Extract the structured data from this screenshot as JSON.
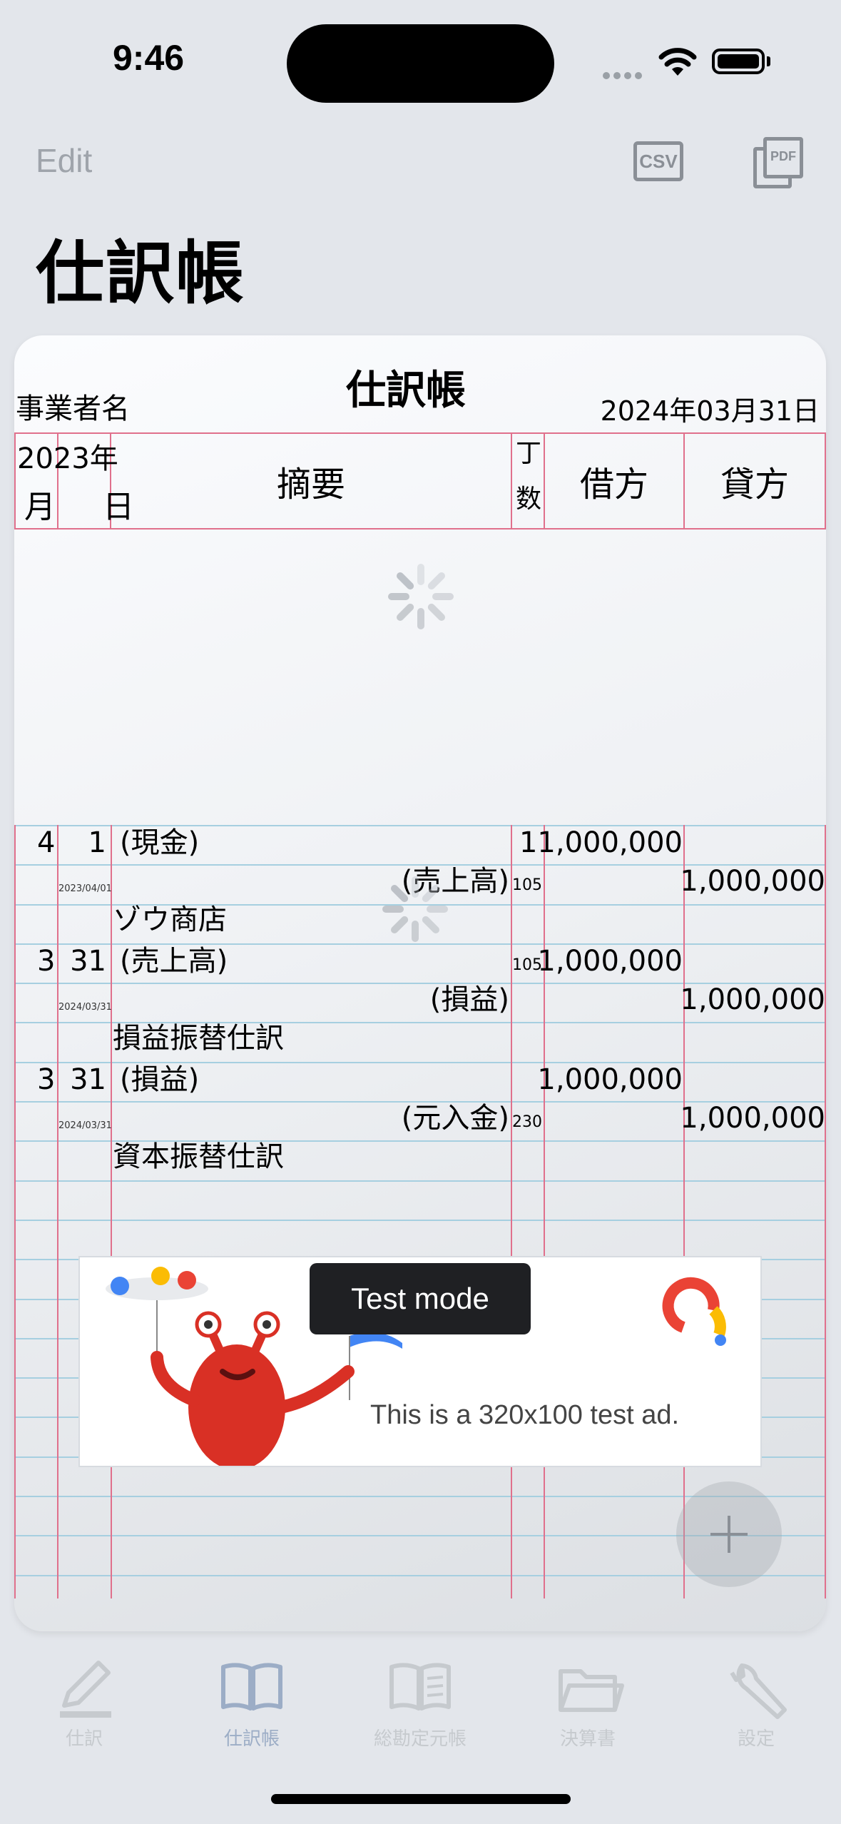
{
  "status_bar": {
    "time": "9:46"
  },
  "nav": {
    "edit_label": "Edit",
    "csv_label": "CSV",
    "pdf_label": "PDF",
    "large_title": "仕訳帳"
  },
  "document": {
    "title": "仕訳帳",
    "business_label": "事業者名",
    "date": "2024年03月31日",
    "header": {
      "year": "2023年",
      "month_day": "月 日",
      "summary": "摘要",
      "page_no": "丁数",
      "debit": "借方",
      "credit": "貸方"
    }
  },
  "entries": [
    {
      "month": "4",
      "day": "1",
      "debit_account": "(現金)",
      "debit_ref": "1",
      "debit_amount": "1,000,000",
      "date_small": "2023/04/01",
      "credit_account": "(売上高)",
      "credit_ref": "105",
      "credit_amount": "1,000,000",
      "memo": "ゾウ商店"
    },
    {
      "month": "3",
      "day": "31",
      "debit_account": "(売上高)",
      "debit_ref": "105",
      "debit_amount": "1,000,000",
      "date_small": "2024/03/31",
      "credit_account": "(損益)",
      "credit_ref": "",
      "credit_amount": "1,000,000",
      "memo": "損益振替仕訳"
    },
    {
      "month": "3",
      "day": "31",
      "debit_account": "(損益)",
      "debit_ref": "",
      "debit_amount": "1,000,000",
      "date_small": "2024/03/31",
      "credit_account": "(元入金)",
      "credit_ref": "230",
      "credit_amount": "1,000,000",
      "memo": "資本振替仕訳"
    }
  ],
  "ad": {
    "badge": "Test mode",
    "text": "This is a 320x100 test ad."
  },
  "tab_bar": {
    "items": [
      {
        "label": "仕訳",
        "icon": "pencil-icon"
      },
      {
        "label": "仕訳帳",
        "icon": "book-icon",
        "active": true
      },
      {
        "label": "総勘定元帳",
        "icon": "ledger-book-icon"
      },
      {
        "label": "決算書",
        "icon": "folder-icon"
      },
      {
        "label": "設定",
        "icon": "wrench-icon"
      }
    ]
  },
  "colors": {
    "ledger_red": "#e0708c",
    "ledger_blue": "#a6cfe0",
    "tab_active": "#9cadc6",
    "tab_inactive": "#c6cace"
  }
}
